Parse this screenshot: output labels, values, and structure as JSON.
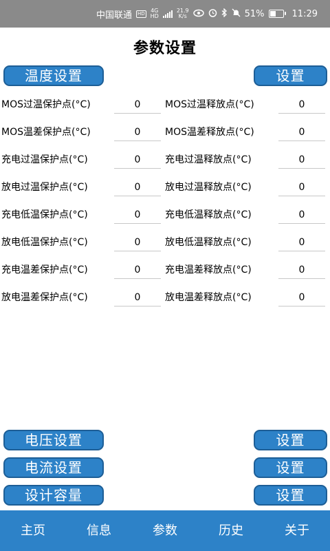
{
  "status_bar": {
    "carrier": "中国联通",
    "hd": "HD",
    "net_type_top": "4G",
    "net_type_bottom": "HD",
    "speed_value": "21.9",
    "speed_unit": "K/s",
    "battery_percent": "51%",
    "battery_level": 0.51,
    "time": "11:29",
    "icons": [
      "eye-icon",
      "alarm-icon",
      "bluetooth-icon",
      "mute-icon"
    ]
  },
  "page": {
    "title": "参数设置"
  },
  "temperature": {
    "section_button": "温度设置",
    "set_button": "设置",
    "rows": [
      {
        "left_label": "MOS过温保护点(°C)",
        "left_value": "0",
        "right_label": "MOS过温释放点(°C)",
        "right_value": "0"
      },
      {
        "left_label": "MOS温差保护点(°C)",
        "left_value": "0",
        "right_label": "MOS温差释放点(°C)",
        "right_value": "0"
      },
      {
        "left_label": "充电过温保护点(°C)",
        "left_value": "0",
        "right_label": "充电过温释放点(°C)",
        "right_value": "0"
      },
      {
        "left_label": "放电过温保护点(°C)",
        "left_value": "0",
        "right_label": "放电过温释放点(°C)",
        "right_value": "0"
      },
      {
        "left_label": "充电低温保护点(°C)",
        "left_value": "0",
        "right_label": "充电低温释放点(°C)",
        "right_value": "0"
      },
      {
        "left_label": "放电低温保护点(°C)",
        "left_value": "0",
        "right_label": "放电低温释放点(°C)",
        "right_value": "0"
      },
      {
        "left_label": "充电温差保护点(°C)",
        "left_value": "0",
        "right_label": "充电温差释放点(°C)",
        "right_value": "0"
      },
      {
        "left_label": "放电温差保护点(°C)",
        "left_value": "0",
        "right_label": "放电温差释放点(°C)",
        "right_value": "0"
      }
    ]
  },
  "sections": [
    {
      "label": "电压设置",
      "set_label": "设置"
    },
    {
      "label": "电流设置",
      "set_label": "设置"
    },
    {
      "label": "设计容量",
      "set_label": "设置"
    }
  ],
  "bottom_nav": {
    "items": [
      {
        "label": "主页"
      },
      {
        "label": "信息"
      },
      {
        "label": "参数"
      },
      {
        "label": "历史"
      },
      {
        "label": "关于"
      }
    ]
  },
  "colors": {
    "accent": "#2d82c8",
    "status_bar": "#8a8a8a"
  }
}
